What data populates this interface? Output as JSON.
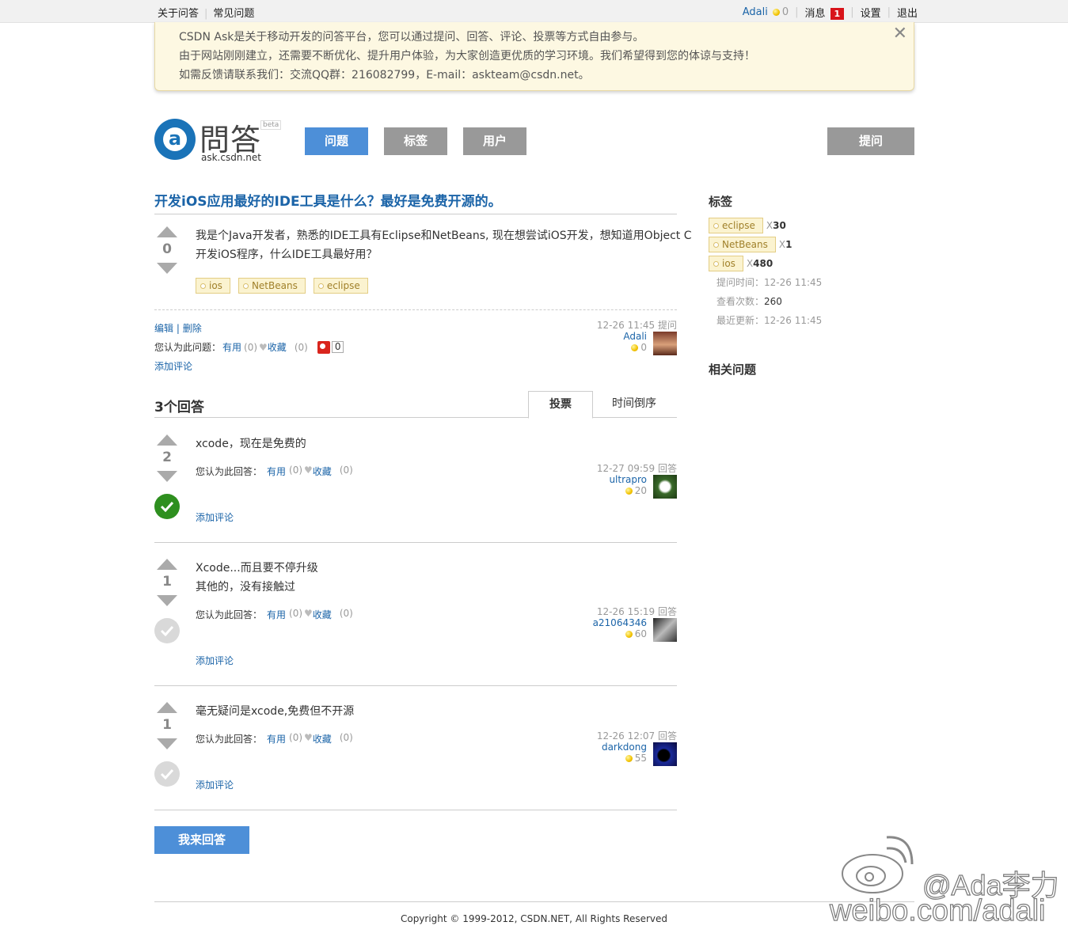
{
  "topbar": {
    "about": "关于问答",
    "faq": "常见问题",
    "username": "Adali",
    "points": "0",
    "messages_label": "消息",
    "messages_count": "1",
    "settings": "设置",
    "logout": "退出"
  },
  "notice": {
    "line1": "CSDN Ask是关于移动开发的问答平台，您可以通过提问、回答、评论、投票等方式自由参与。",
    "line2": "由于网站刚刚建立，还需要不断优化、提升用户体验，为大家创造更优质的学习环境。我们希望得到您的体谅与支持！",
    "line3": "如需反馈请联系我们：交流QQ群：216082799，E-mail：askteam@csdn.net。",
    "close": "✕"
  },
  "logo": {
    "mark": "問答",
    "beta": "beta",
    "domain": "ask.csdn.net",
    "glyph": "a"
  },
  "nav": {
    "questions": "问题",
    "tags": "标签",
    "users": "用户",
    "ask": "提问"
  },
  "question": {
    "title": "开发iOS应用最好的IDE工具是什么？最好是免费开源的。",
    "votes": "0",
    "body_line1": "我是个Java开发者，熟悉的IDE工具有Eclipse和NetBeans, 现在想尝试iOS开发，想知道用Object C",
    "body_line2": "开发iOS程序，什么IDE工具最好用？",
    "tags": [
      "ios",
      "NetBeans",
      "eclipse"
    ],
    "edit": "编辑",
    "delete": "删除",
    "opinion_label": "您认为此问题：",
    "useful": "有用",
    "useful_count": "(0)",
    "favorite": "收藏",
    "favorite_count": "(0)",
    "share_count": "0",
    "add_comment": "添加评论",
    "time": "12-26 11:45 提问",
    "author": "Adali",
    "author_points": "0"
  },
  "answers_header": {
    "count": "3个回答",
    "tab_votes": "投票",
    "tab_time": "时间倒序"
  },
  "answers": [
    {
      "votes": "2",
      "line1": "xcode，现在是免费的",
      "line2": "",
      "accepted": true,
      "opinion_label": "您认为此回答：",
      "useful": "有用",
      "useful_count": "(0)",
      "favorite": "收藏",
      "favorite_count": "(0)",
      "time": "12-27 09:59 回答",
      "author": "ultrapro",
      "author_points": "20",
      "add_comment": "添加评论"
    },
    {
      "votes": "1",
      "line1": "Xcode...而且要不停升级",
      "line2": "其他的，没有接触过",
      "accepted": false,
      "opinion_label": "您认为此回答：",
      "useful": "有用",
      "useful_count": "(0)",
      "favorite": "收藏",
      "favorite_count": "(0)",
      "time": "12-26 15:19 回答",
      "author": "a21064346",
      "author_points": "60",
      "add_comment": "添加评论"
    },
    {
      "votes": "1",
      "line1": "毫无疑问是xcode,免费但不开源",
      "line2": "",
      "accepted": false,
      "opinion_label": "您认为此回答：",
      "useful": "有用",
      "useful_count": "(0)",
      "favorite": "收藏",
      "favorite_count": "(0)",
      "time": "12-26 12:07 回答",
      "author": "darkdong",
      "author_points": "55",
      "add_comment": "添加评论"
    }
  ],
  "answer_button": "我来回答",
  "sidebar": {
    "tags_heading": "标签",
    "tags": [
      {
        "name": "eclipse",
        "x": "X",
        "count": "30"
      },
      {
        "name": "NetBeans",
        "x": "X",
        "count": "1"
      },
      {
        "name": "ios",
        "x": "X",
        "count": "480"
      }
    ],
    "asked_label": "提问时间：",
    "asked_value": "12-26 11:45",
    "views_label": "查看次数：",
    "views_value": "260",
    "updated_label": "最近更新：",
    "updated_value": "12-26 11:45",
    "related_heading": "相关问题"
  },
  "footer": "Copyright © 1999-2012, CSDN.NET, All Rights Reserved",
  "watermark": {
    "handle": "@Ada李力",
    "url": "weibo.com/adali"
  },
  "colors": {
    "link": "#1b64a8",
    "nav_active": "#4d8fd8",
    "nav_inactive": "#999999",
    "accept": "#2e8f1f",
    "tag_bg": "#fbf3d0",
    "notice_bg": "#fdf8e2"
  }
}
